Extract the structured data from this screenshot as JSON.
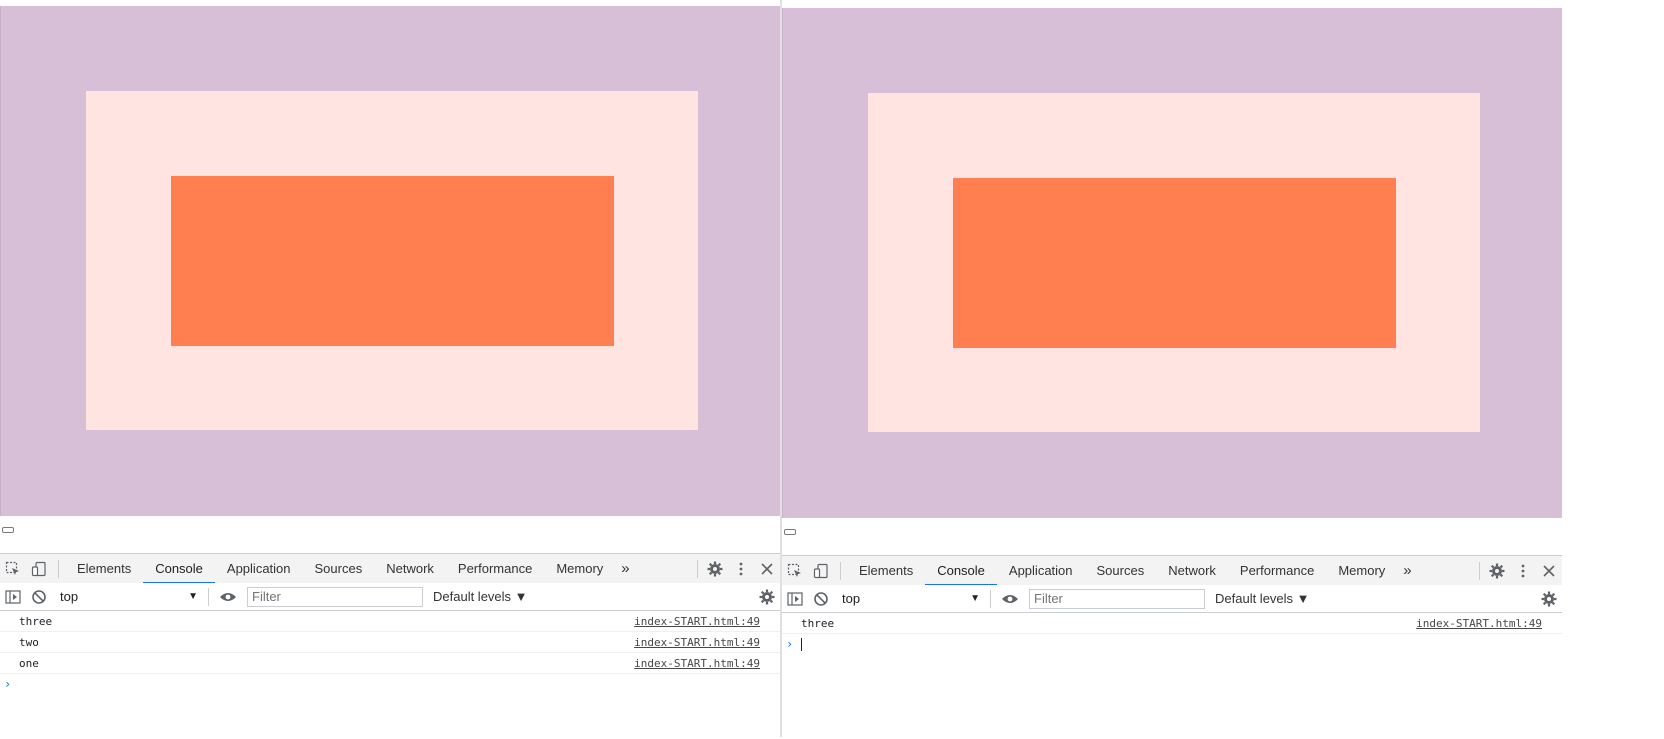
{
  "devtools": {
    "tabs": [
      "Elements",
      "Console",
      "Application",
      "Sources",
      "Network",
      "Performance",
      "Memory"
    ],
    "more_tabs": "»",
    "context": "top",
    "filter_placeholder": "Filter",
    "levels": "Default levels ▼",
    "prompt_symbol": "›"
  },
  "left": {
    "console_rows": [
      {
        "message": "three",
        "source": "index-START.html:49"
      },
      {
        "message": "two",
        "source": "index-START.html:49"
      },
      {
        "message": "one",
        "source": "index-START.html:49"
      }
    ]
  },
  "right": {
    "console_rows": [
      {
        "message": "three",
        "source": "index-START.html:49"
      }
    ]
  },
  "colors": {
    "outer": "#d8bfd8",
    "middle": "#ffe4e1",
    "inner": "#ff7f50",
    "active_tab": "#1a73e8"
  }
}
